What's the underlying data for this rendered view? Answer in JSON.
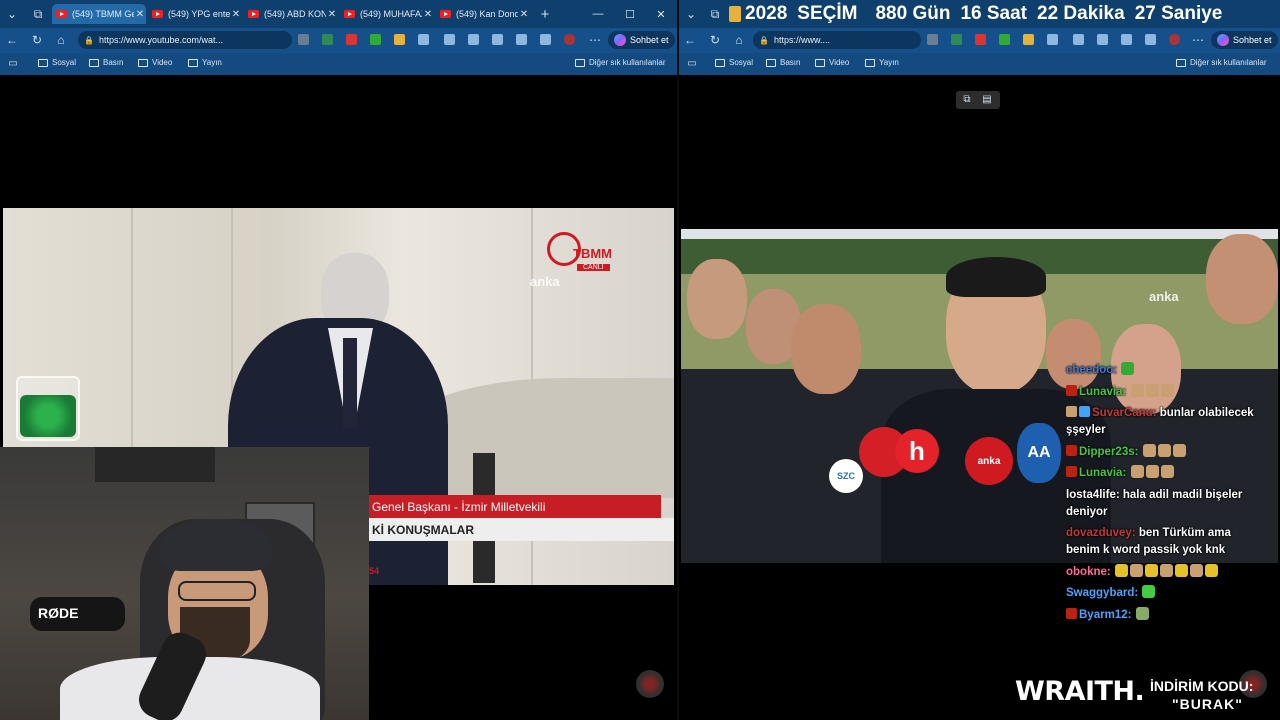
{
  "left_browser": {
    "tabs": [
      {
        "label": "(549) TBMM Gen"
      },
      {
        "label": "(549) YPG enteg"
      },
      {
        "label": "(549) ABD KONU"
      },
      {
        "label": "(549) MUHAFAZ"
      },
      {
        "label": "(549) Kan Dondu"
      }
    ],
    "url": "https://www.youtube.com/wat...",
    "chat_button": "Sohbet et",
    "favorites": [
      "Sosyal",
      "Basın",
      "Video",
      "Yayın"
    ],
    "other_favorites": "Diğer sık kullanılanlar",
    "video": {
      "watermark_logo": "TBMM",
      "watermark_sub": "CANLI",
      "agency": "anka",
      "caption_red": "Genel Başkanı - İzmir Milletvekili",
      "caption_white": "Kİ KONUŞMALAR",
      "timecode": "54"
    }
  },
  "right_browser": {
    "countdown": {
      "year": "2028",
      "label": "SEÇİM",
      "days": "880 Gün",
      "hours": "16 Saat",
      "minutes": "22 Dakika",
      "seconds": "27 Saniye"
    },
    "url": "https://www....",
    "chat_button": "Sohbet et",
    "favorites": [
      "Sosyal",
      "Basın",
      "Video",
      "Yayın"
    ],
    "other_favorites": "Diğer sık kullanılanlar",
    "video": {
      "agency": "anka",
      "mic_labels": [
        "SZC",
        "h",
        "anka",
        "AA"
      ]
    }
  },
  "chat": [
    {
      "user": "cheedoo:",
      "msg": "",
      "color": "#3f7bd6"
    },
    {
      "user": "Lunavia:",
      "msg": "",
      "color": "#46c846"
    },
    {
      "user": "SuvarCanu:",
      "msg": "bunlar olabilecek şşeyler",
      "color": "#c23a3a"
    },
    {
      "user": "Dipper23s:",
      "msg": "",
      "color": "#46c846"
    },
    {
      "user": "Lunavia:",
      "msg": "",
      "color": "#46c846"
    },
    {
      "user": "losta4life:",
      "msg": "hala adil madil bişeler deniyor",
      "color": "#ffffff"
    },
    {
      "user": "dovazduvey:",
      "msg": "ben Türküm ama benim k word passik yok knk",
      "color": "#c23a3a"
    },
    {
      "user": "obokne:",
      "msg": "",
      "color": "#ff6a9a"
    },
    {
      "user": "Swaggybard:",
      "msg": "",
      "color": "#4aa3ff"
    },
    {
      "user": "Byarm12:",
      "msg": "",
      "color": "#4aa3ff"
    }
  ],
  "sponsor": {
    "brand": "WRAITH.",
    "promo": "İNDİRİM KODU:",
    "code": "\"BURAK\""
  },
  "webcam": {
    "mic_brand": "RØDE"
  }
}
